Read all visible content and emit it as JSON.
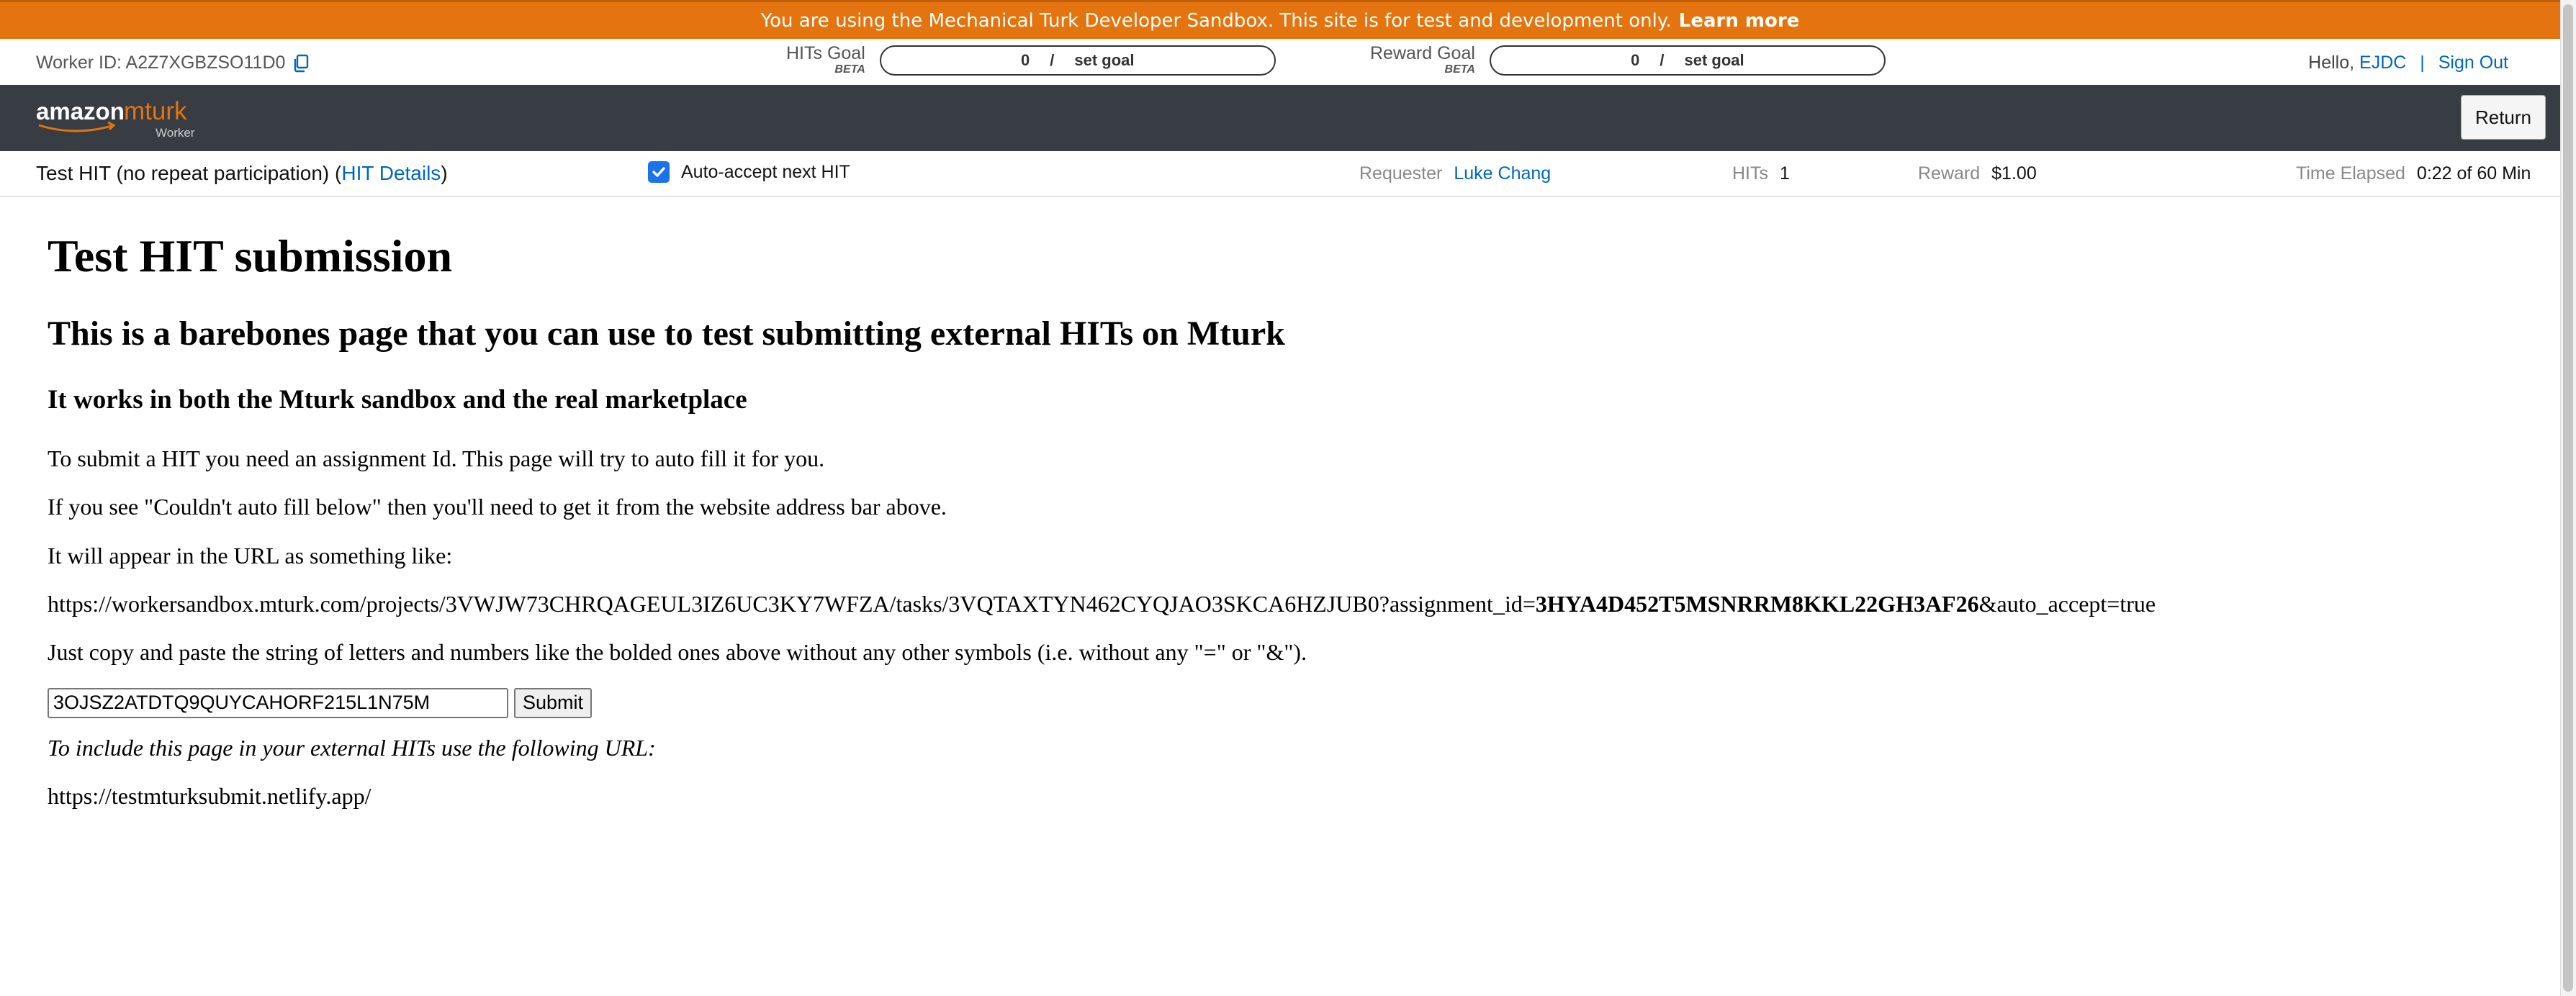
{
  "banner": {
    "message": "You are using the Mechanical Turk Developer Sandbox. This site is for test and development only.",
    "link": "Learn more"
  },
  "info": {
    "worker_id": "Worker ID: A2Z7XGBZSO11D0",
    "hits_goal": {
      "label": "HITs Goal",
      "beta": "BETA",
      "value": "0",
      "slash": "/",
      "action": "set goal"
    },
    "reward_goal": {
      "label": "Reward Goal",
      "beta": "BETA",
      "value": "0",
      "slash": "/",
      "action": "set goal"
    },
    "hello": "Hello,",
    "user": "EJDC",
    "separator": "|",
    "sign_out": "Sign Out"
  },
  "navbar": {
    "logo_amazon": "amazon",
    "logo_mturk": "mturk",
    "logo_worker": "Worker",
    "return_label": "Return"
  },
  "hit": {
    "title": "Test HIT (no repeat participation) (",
    "details_link": "HIT Details",
    "title_close": ")",
    "auto_accept": "Auto-accept next HIT",
    "requester_label": "Requester",
    "requester": "Luke Chang",
    "hits_label": "HITs",
    "hits": "1",
    "reward_label": "Reward",
    "reward": "$1.00",
    "time_label": "Time Elapsed",
    "time": "0:22 of 60 Min"
  },
  "content": {
    "h1": "Test HIT submission",
    "h2": "This is a barebones page that you can use to test submitting external HITs on Mturk",
    "h3": "It works in both the Mturk sandbox and the real marketplace",
    "p1": "To submit a HIT you need an assignment Id. This page will try to auto fill it for you.",
    "p2": "If you see \"Couldn't auto fill below\" then you'll need to get it from the website address bar above.",
    "p3": "It will appear in the URL as something like:",
    "url_prefix": "https://workersandbox.mturk.com/projects/3VWJW73CHRQAGEUL3IZ6UC3KY7WFZA/tasks/3VQTAXTYN462CYQJAO3SKCA6HZJUB0?assignment_id=",
    "url_bold": "3HYA4D452T5MSNRRM8KKL22GH3AF26",
    "url_suffix": "&auto_accept=true",
    "p4": "Just copy and paste the string of letters and numbers like the bolded ones above without any other symbols (i.e. without any \"=\" or \"&\").",
    "input_value": "3OJSZ2ATDTQ9QUYCAHORF215L1N75M",
    "submit_label": "Submit",
    "include_text": "To include this page in your external HITs use the following URL:",
    "submit_url": "https://testmturksubmit.netlify.app/"
  },
  "colors": {
    "banner": "#e3740f",
    "navbar": "#383c43",
    "link": "#0066c0",
    "logo_accent": "#e3740f",
    "checkbox": "#1a73e8"
  },
  "icons": {
    "copy": "copy-icon",
    "checkbox": "checkmark-icon"
  }
}
